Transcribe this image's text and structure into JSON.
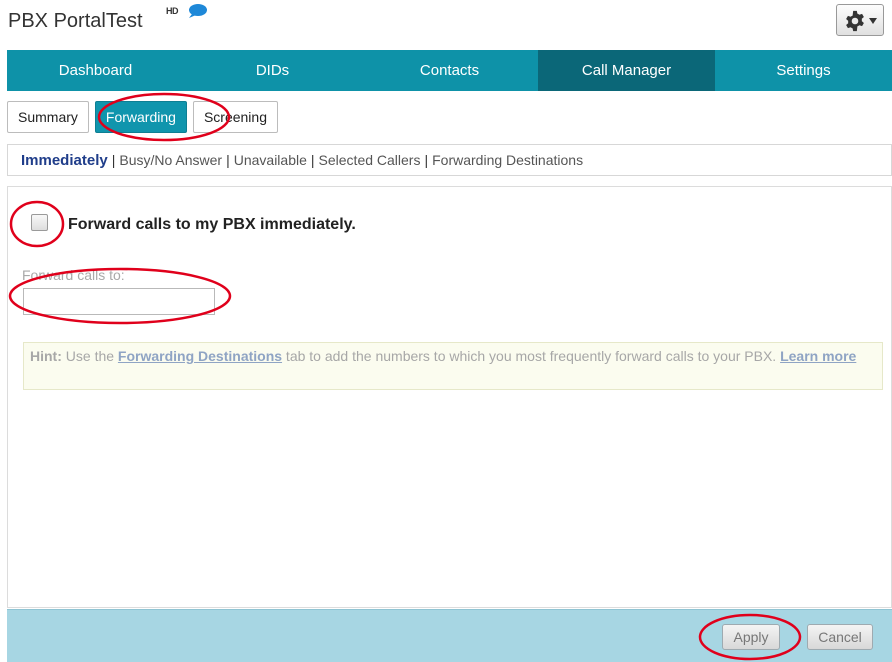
{
  "header": {
    "title": "PBX PortalTest",
    "hd_badge": "HD",
    "chat_icon": "chat-bubble-icon",
    "settings_icon": "gear-icon",
    "settings_caret_icon": "chevron-down-icon"
  },
  "nav": {
    "items": [
      {
        "label": "Dashboard"
      },
      {
        "label": "DIDs"
      },
      {
        "label": "Contacts"
      },
      {
        "label": "Call Manager",
        "active": true
      },
      {
        "label": "Settings"
      }
    ]
  },
  "subtabs": {
    "items": [
      {
        "label": "Summary"
      },
      {
        "label": "Forwarding",
        "active": true
      },
      {
        "label": "Screening"
      }
    ]
  },
  "subnav": {
    "items": [
      {
        "label": "Immediately",
        "active": true
      },
      {
        "label": "Busy/No Answer"
      },
      {
        "label": "Unavailable"
      },
      {
        "label": "Selected Callers"
      },
      {
        "label": "Forwarding Destinations"
      }
    ],
    "separator": "|"
  },
  "form": {
    "checkbox_label": "Forward calls to my PBX immediately.",
    "checkbox_checked": false,
    "forward_to_label": "Forward calls to:",
    "forward_to_value": ""
  },
  "hint": {
    "prefix": "Hint:",
    "text_before": " Use the ",
    "link1": "Forwarding Destinations",
    "text_after": " tab to add the numbers to which you most frequently forward calls to your PBX. ",
    "link2": "Learn more"
  },
  "footer": {
    "apply_label": "Apply",
    "cancel_label": "Cancel"
  },
  "colors": {
    "nav_bg": "#0e92a8",
    "nav_active": "#0b6778",
    "footer_bg": "#a7d6e3",
    "annotation_red": "#e0001b"
  }
}
